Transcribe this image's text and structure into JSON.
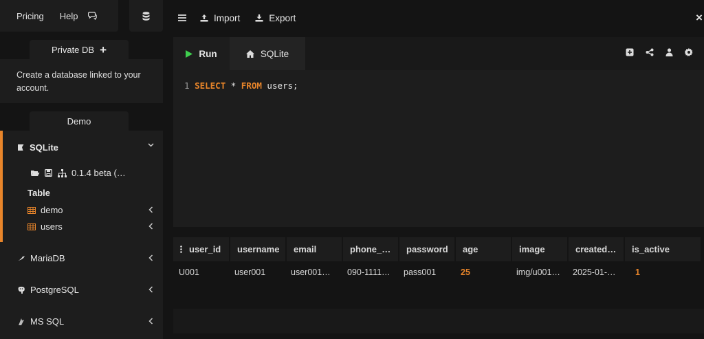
{
  "topnav": {
    "pricing": "Pricing",
    "help": "Help"
  },
  "sidebar": {
    "private_db": {
      "label": "Private DB",
      "add": "+"
    },
    "create_text": "Create a database linked to your account.",
    "demo_label": "Demo",
    "sqlite": {
      "label": "SQLite",
      "version": "0.1.4 beta (…",
      "table_heading": "Table",
      "tables": [
        "demo",
        "users"
      ]
    },
    "databases": [
      "MariaDB",
      "PostgreSQL",
      "MS SQL"
    ]
  },
  "toolbar": {
    "import": "Import",
    "export": "Export",
    "close": "×"
  },
  "editor": {
    "run_label": "Run",
    "tab_label": "SQLite",
    "line_number": "1",
    "kw_select": "SELECT",
    "star": " * ",
    "kw_from": "FROM",
    "rest": " users;"
  },
  "results": {
    "headers": [
      "user_id",
      "username",
      "email",
      "phone_…",
      "password",
      "age",
      "image",
      "created…",
      "is_active"
    ],
    "rows": [
      [
        "U001",
        "user001",
        "user001…",
        "090-1111…",
        "pass001",
        "25",
        "img/u001…",
        "2025-01-…",
        "1"
      ]
    ]
  },
  "colors": {
    "accent": "#e8852a",
    "run_green": "#3fcf4f"
  }
}
